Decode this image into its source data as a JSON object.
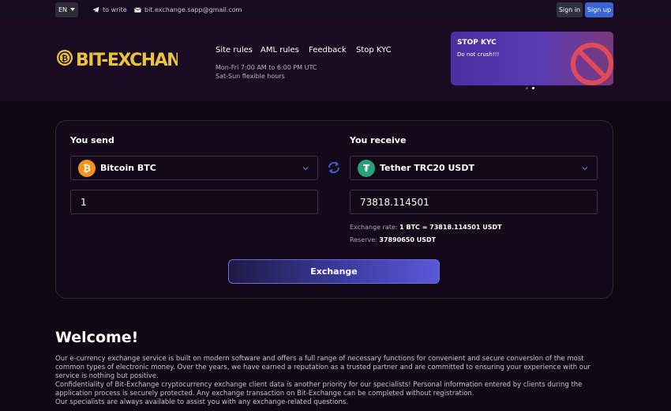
{
  "topbar": {
    "language": "EN",
    "write_label": "to write",
    "email": "bit.exchange.sapp@gmail.com",
    "signin_label": "Sign in",
    "signup_label": "Sign up"
  },
  "header": {
    "logo_text": "BIT-EXCHANGE",
    "nav": [
      "Site rules",
      "AML rules",
      "Feedback",
      "Stop KYC"
    ],
    "hours_weekday": "Mon-Fri 7:00 AM to 6:00 PM UTC",
    "hours_weekend": "Sat-Sun flexible hours",
    "promo": {
      "title": "STOP KYC",
      "text": "Do not crush!!!"
    }
  },
  "exchange": {
    "send_label": "You send",
    "receive_label": "You receive",
    "send_currency": "Bitcoin BTC",
    "receive_currency": "Tether TRC20 USDT",
    "send_amount": "1",
    "receive_amount": "73818.114501",
    "rate_label": "Exchange rate:",
    "rate_value": "1 BTC = 73818.114501 USDT",
    "reserve_label": "Reserve:",
    "reserve_value": "37890650 USDT",
    "button_label": "Exchange"
  },
  "welcome": {
    "title": "Welcome!",
    "line1": "Our e-currency exchange service is built on modern software and offers a full range of necessary functions for convenient and secure conversion of the most",
    "line2": "common types of electronic money. Over the years, we have earned a reputation as a trusted partner and are committed to ensuring your experience with our",
    "line3": "service is nothing but positive.",
    "line4": "Confidentiality of Bit-Exchange cryptocurrency exchange client data is another priority for our specialists! Personal information entered by clients during the",
    "line5": "application process is securely protected. Any exchange transaction on Bit-Exchange can be completed without registration.",
    "line6": "Our specialists are always available to assist you with any exchange-related questions."
  },
  "colors": {
    "background": "#0f0714",
    "accent": "#3a63d6",
    "btc": "#f7931a",
    "usdt": "#26a17b",
    "logo_gold": "#e8c43c"
  }
}
